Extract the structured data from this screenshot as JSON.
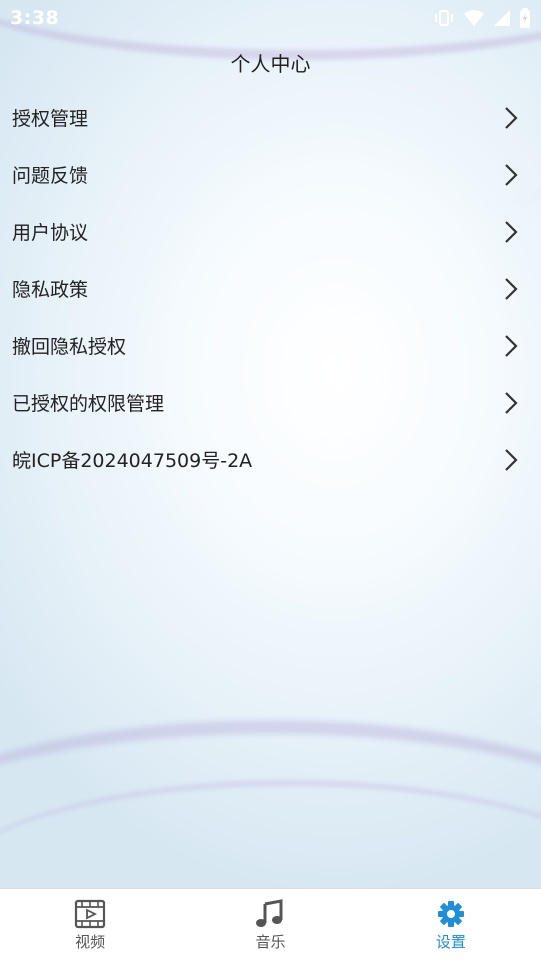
{
  "status_bar": {
    "time": "3:38"
  },
  "header": {
    "title": "个人中心"
  },
  "menu": {
    "items": [
      {
        "label": "授权管理"
      },
      {
        "label": "问题反馈"
      },
      {
        "label": "用户协议"
      },
      {
        "label": "隐私政策"
      },
      {
        "label": "撤回隐私授权"
      },
      {
        "label": "已授权的权限管理"
      },
      {
        "label": "皖ICP备2024047509号-2A"
      }
    ]
  },
  "tabbar": {
    "tabs": [
      {
        "label": "视频",
        "icon": "video-icon"
      },
      {
        "label": "音乐",
        "icon": "music-note-icon"
      },
      {
        "label": "设置",
        "icon": "gear-icon",
        "active": true
      }
    ]
  },
  "colors": {
    "accent": "#1e8fd8",
    "text": "#222222",
    "inactive_tab": "#555555"
  }
}
